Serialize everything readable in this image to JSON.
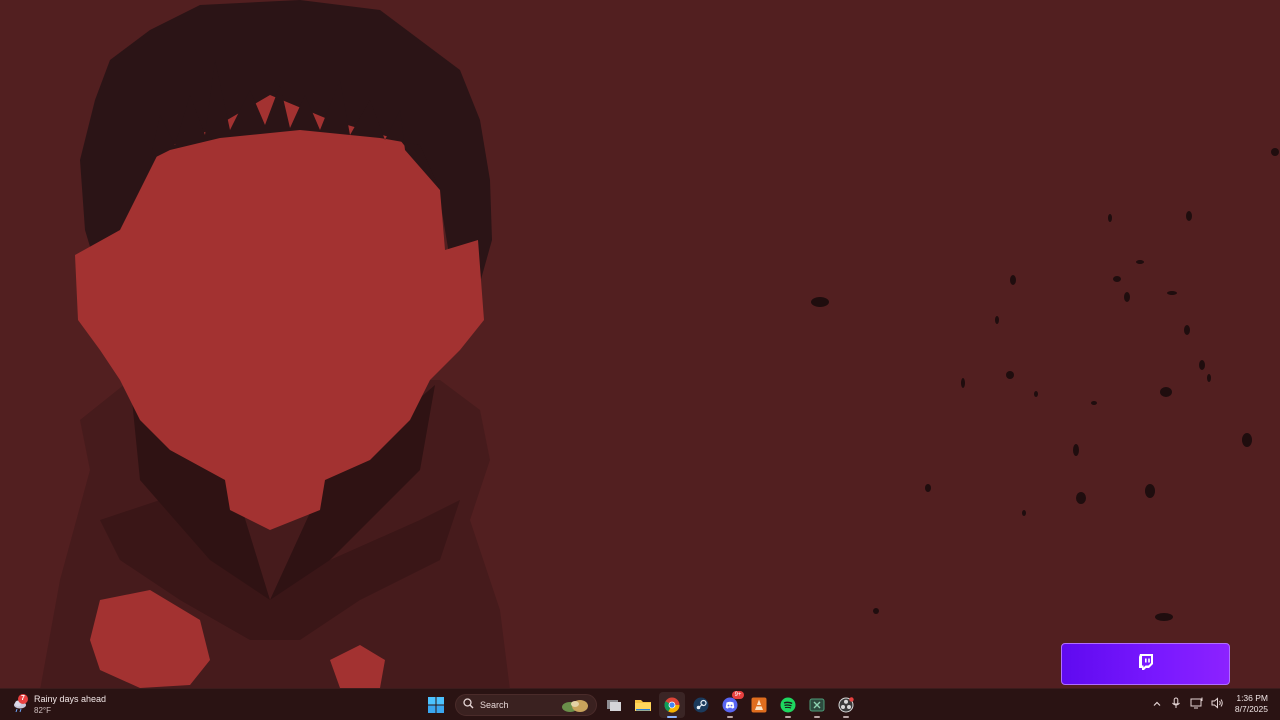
{
  "taskbar": {
    "weather": {
      "icon": "rain-cloud-icon",
      "badge": "7",
      "summary": "Rainy days ahead",
      "temperature": "82°F"
    },
    "search": {
      "placeholder": "Search"
    },
    "apps": [
      {
        "name": "start-button",
        "icon": "windows-logo-icon"
      },
      {
        "name": "task-view-button",
        "icon": "task-view-icon"
      },
      {
        "name": "file-explorer",
        "icon": "folder-icon"
      },
      {
        "name": "chrome",
        "icon": "chrome-icon"
      },
      {
        "name": "steam",
        "icon": "steam-icon"
      },
      {
        "name": "discord",
        "icon": "discord-icon",
        "badge": "9+"
      },
      {
        "name": "vlc",
        "icon": "vlc-cone-icon"
      },
      {
        "name": "spotify",
        "icon": "spotify-icon"
      },
      {
        "name": "xbox-app",
        "icon": "xbox-icon"
      },
      {
        "name": "obs",
        "icon": "obs-icon"
      }
    ],
    "clock": {
      "time": "1:36 PM",
      "date": "8/7/2025"
    }
  },
  "widget": {
    "name": "twitch",
    "icon": "twitch-icon",
    "color": "#7a19ff"
  },
  "colors": {
    "wallpaper_bg": "#521f20",
    "figure_face": "#a33231",
    "hair": "#2b1416",
    "taskbar": "#2a1313"
  }
}
